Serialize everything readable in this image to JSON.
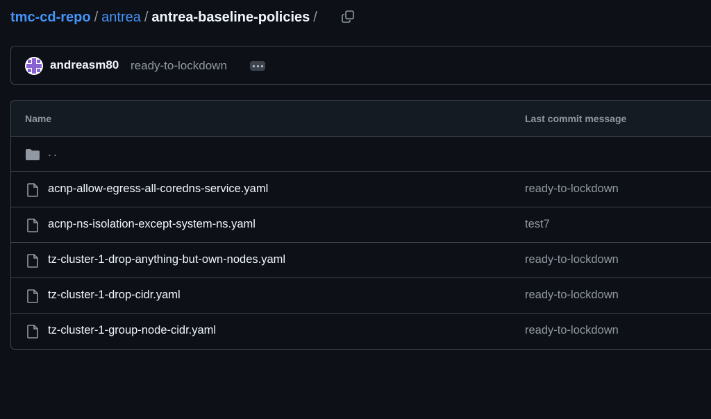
{
  "breadcrumb": {
    "repo": "tmc-cd-repo",
    "folder": "antrea",
    "current": "antrea-baseline-policies",
    "separator": "/"
  },
  "icons": {
    "copy": "copy-icon",
    "folder": "folder-icon",
    "file": "file-icon",
    "ellipsis": "ellipsis-icon"
  },
  "colors": {
    "background": "#0d1117",
    "link": "#4493f8",
    "muted": "#9198a1",
    "border": "#3d444d",
    "avatar": "#8a63d2"
  },
  "latest_commit": {
    "author": "andreasm80",
    "message": "ready-to-lockdown"
  },
  "table": {
    "headers": {
      "name": "Name",
      "last_commit_message": "Last commit message"
    },
    "parent_dir": "..",
    "files": [
      {
        "name": "acnp-allow-egress-all-coredns-service.yaml",
        "message": "ready-to-lockdown"
      },
      {
        "name": "acnp-ns-isolation-except-system-ns.yaml",
        "message": "test7"
      },
      {
        "name": "tz-cluster-1-drop-anything-but-own-nodes.yaml",
        "message": "ready-to-lockdown"
      },
      {
        "name": "tz-cluster-1-drop-cidr.yaml",
        "message": "ready-to-lockdown"
      },
      {
        "name": "tz-cluster-1-group-node-cidr.yaml",
        "message": "ready-to-lockdown"
      }
    ]
  }
}
